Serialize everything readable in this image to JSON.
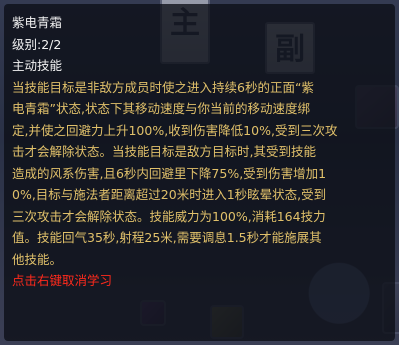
{
  "skill": {
    "name": "紫电青霜",
    "level": "级别:2/2",
    "type": "主动技能",
    "description_lines": [
      "当技能目标是非敌方成员时使之进入持续6秒的正面“紫",
      "电青霜”状态,状态下其移动速度与你当前的移动速度绑",
      "定,并使之回避力上升100%,收到伤害降低10%,受到三次攻",
      "击才会解除状态。当技能目标是敌方目标时,其受到技能",
      "造成的风系伤害,且6秒内回避里下降75%,受到伤害增加1",
      "0%,目标与施法者距离超过20米时进入1秒眩晕状态,受到",
      "三次攻击才会解除状态。技能威力为100%,消耗164技力",
      "值。技能回气35秒,射程25米,需要调息1.5秒才能施展其",
      "他技能。"
    ],
    "hint": "点击右键取消学习"
  },
  "background": {
    "banner_left_glyph": "主",
    "banner_right_glyph": "副"
  },
  "colors": {
    "name": "#f2f2f2",
    "description": "#e0c06a",
    "hint": "#ff2a1c"
  }
}
